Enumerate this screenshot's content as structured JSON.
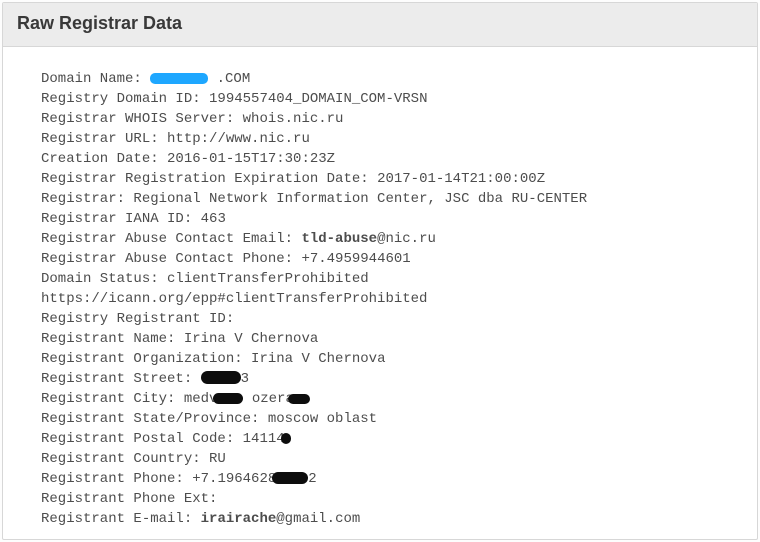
{
  "header": {
    "title": "Raw Registrar Data"
  },
  "whois": {
    "domain_name_label": "Domain Name: ",
    "domain_name_suffix": ".COM",
    "registry_domain_id_label": "Registry Domain ID: ",
    "registry_domain_id": "1994557404_DOMAIN_COM-VRSN",
    "registrar_whois_server_label": "Registrar WHOIS Server: ",
    "registrar_whois_server": "whois.nic.ru",
    "registrar_url_label": "Registrar URL: ",
    "registrar_url": "http://www.nic.ru",
    "creation_date_label": "Creation Date: ",
    "creation_date": "2016-01-15T17:30:23Z",
    "expiration_label": "Registrar Registration Expiration Date: ",
    "expiration": "2017-01-14T21:00:00Z",
    "registrar_label": "Registrar: ",
    "registrar": "Regional Network Information Center, JSC dba RU-CENTER",
    "iana_id_label": "Registrar IANA ID: ",
    "iana_id": "463",
    "abuse_email_label": "Registrar Abuse Contact Email: ",
    "abuse_email_local": "tld-abuse",
    "abuse_email_domain": "@nic.ru",
    "abuse_phone_label": "Registrar Abuse Contact Phone: ",
    "abuse_phone": "+7.4959944601",
    "domain_status_label": "Domain Status: ",
    "domain_status": "clientTransferProhibited",
    "domain_status_url": "https://icann.org/epp#clientTransferProhibited",
    "registrant_id_label": "Registry Registrant ID:",
    "reg_name_label": "Registrant Name: ",
    "reg_name": "Irina V Chernova",
    "reg_org_label": "Registrant Organization: ",
    "reg_org": "Irina V Chernova",
    "reg_street_label": "Registrant Street: ",
    "reg_street_suffix": "3",
    "reg_city_label": "Registrant City: ",
    "reg_city_prefix": "medv",
    "reg_city_mid": " ozera",
    "reg_state_label": "Registrant State/Province: ",
    "reg_state": "moscow oblast",
    "reg_postal_label": "Registrant Postal Code: ",
    "reg_postal_prefix": "14114",
    "reg_country_label": "Registrant Country: ",
    "reg_country": "RU",
    "reg_phone_label": "Registrant Phone: ",
    "reg_phone_prefix": "+7.1964628",
    "reg_phone_suffix": "2",
    "reg_phone_ext_label": "Registrant Phone Ext:",
    "reg_email_label": "Registrant E-mail: ",
    "reg_email_local": "irairache",
    "reg_email_domain": "@gmail.com"
  }
}
